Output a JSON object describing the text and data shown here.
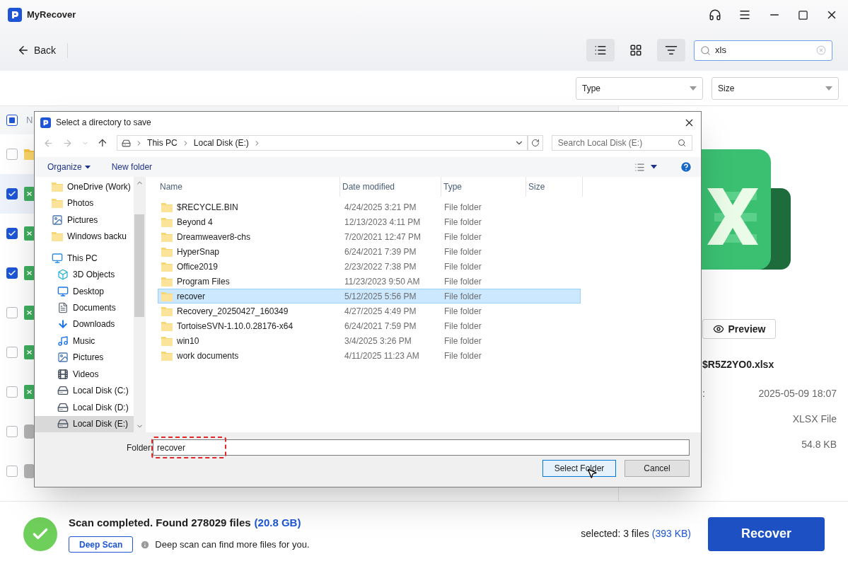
{
  "app": {
    "title": "MyRecover"
  },
  "toolbar": {
    "back": "Back",
    "view_modes": [
      {
        "kind": "list",
        "selected": true
      },
      {
        "kind": "grid",
        "selected": false
      }
    ],
    "filter_active": true,
    "search": {
      "value": "xls"
    }
  },
  "filters": [
    {
      "label": "Type"
    },
    {
      "label": "Size"
    }
  ],
  "file_list": {
    "header": {
      "label": "N",
      "indeterminate": true
    },
    "rows": [
      {
        "kind": "folder",
        "checked": false,
        "selected": false
      },
      {
        "kind": "excel",
        "checked": true,
        "selected": true
      },
      {
        "kind": "excel",
        "checked": true,
        "selected": false
      },
      {
        "kind": "excel",
        "checked": true,
        "selected": false
      },
      {
        "kind": "excel",
        "checked": false,
        "selected": false
      },
      {
        "kind": "excel",
        "checked": false,
        "selected": false
      },
      {
        "kind": "excel",
        "checked": false,
        "selected": false
      },
      {
        "kind": "unknown",
        "checked": false,
        "selected": false
      },
      {
        "kind": "unknown",
        "checked": false,
        "selected": false
      }
    ]
  },
  "preview": {
    "button": "Preview",
    "file_name": "$R5Z2YO0.xlsx",
    "details": [
      {
        "label": ":",
        "value": "2025-05-09 18:07"
      },
      {
        "value": "XLSX File"
      },
      {
        "value": "54.8 KB"
      }
    ]
  },
  "status": {
    "message": "Scan completed. Found 278029 files",
    "size": "(20.8 GB)",
    "deep_scan": "Deep Scan",
    "hint": "Deep scan can find more files for you.",
    "selected": "selected: 3 files",
    "selected_size": "(393 KB)",
    "recover": "Recover"
  },
  "dialog": {
    "title": "Select a directory to save",
    "breadcrumb": [
      "This PC",
      "Local Disk (E:)"
    ],
    "search": {
      "placeholder": "Search Local Disk (E:)"
    },
    "commands": [
      "Organize",
      "New folder"
    ],
    "nav": [
      {
        "label": "OneDrive (Work)",
        "kind": "folder",
        "selected": false
      },
      {
        "label": "Photos",
        "kind": "folder",
        "selected": false
      },
      {
        "label": "Pictures",
        "kind": "picture",
        "selected": false
      },
      {
        "label": "Windows backu",
        "kind": "folder",
        "selected": false
      },
      {
        "label": "This PC",
        "kind": "pc",
        "selected": false,
        "children": [
          {
            "label": "3D Objects",
            "kind": "cube",
            "selected": false
          },
          {
            "label": "Desktop",
            "kind": "desktop",
            "selected": false
          },
          {
            "label": "Documents",
            "kind": "document",
            "selected": false
          },
          {
            "label": "Downloads",
            "kind": "download",
            "selected": false
          },
          {
            "label": "Music",
            "kind": "music",
            "selected": false
          },
          {
            "label": "Pictures",
            "kind": "picture",
            "selected": false
          },
          {
            "label": "Videos",
            "kind": "video",
            "selected": false
          },
          {
            "label": "Local Disk (C:)",
            "kind": "disk",
            "selected": false
          },
          {
            "label": "Local Disk (D:)",
            "kind": "disk",
            "selected": false
          },
          {
            "label": "Local Disk (E:)",
            "kind": "disk",
            "selected": true
          }
        ]
      }
    ],
    "columns": [
      "Name",
      "Date modified",
      "Type",
      "Size"
    ],
    "rows": [
      {
        "name": "$RECYCLE.BIN",
        "date": "4/24/2025 3:21 PM",
        "type": "File folder",
        "selected": false
      },
      {
        "name": "Beyond 4",
        "date": "12/13/2023 4:11 PM",
        "type": "File folder",
        "selected": false
      },
      {
        "name": "Dreamweaver8-chs",
        "date": "7/20/2021 12:47 PM",
        "type": "File folder",
        "selected": false
      },
      {
        "name": "HyperSnap",
        "date": "6/24/2021 7:39 PM",
        "type": "File folder",
        "selected": false
      },
      {
        "name": "Office2019",
        "date": "2/23/2022 7:38 PM",
        "type": "File folder",
        "selected": false
      },
      {
        "name": "Program Files",
        "date": "11/23/2023 9:50 AM",
        "type": "File folder",
        "selected": false
      },
      {
        "name": "recover",
        "date": "5/12/2025 5:56 PM",
        "type": "File folder",
        "selected": true
      },
      {
        "name": "Recovery_20250427_160349",
        "date": "4/27/2025 4:49 PM",
        "type": "File folder",
        "selected": false
      },
      {
        "name": "TortoiseSVN-1.10.0.28176-x64",
        "date": "6/24/2021 7:59 PM",
        "type": "File folder",
        "selected": false
      },
      {
        "name": "win10",
        "date": "3/4/2025 3:26 PM",
        "type": "File folder",
        "selected": false
      },
      {
        "name": "work documents",
        "date": "4/11/2025 11:23 AM",
        "type": "File folder",
        "selected": false
      }
    ],
    "folder": {
      "label": "Folder:",
      "value": "recover",
      "highlighted": true
    },
    "buttons": [
      {
        "label": "Select Folder",
        "kind": "primary"
      },
      {
        "label": "Cancel",
        "kind": "secondary"
      }
    ]
  }
}
